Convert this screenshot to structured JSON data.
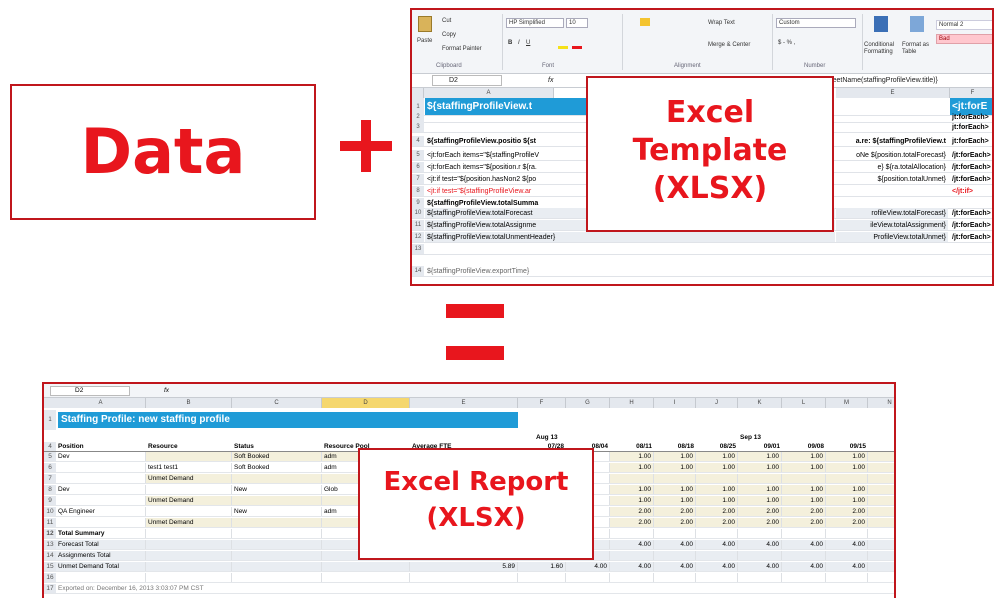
{
  "data_label": "Data",
  "plus_label": "+",
  "template_label": [
    "Excel",
    "Template",
    "(XLSX)"
  ],
  "report_label": [
    "Excel Report",
    "(XLSX)"
  ],
  "colors": {
    "red": "#e8161d",
    "blue": "#1f9bd7"
  },
  "template": {
    "ribbon": {
      "paste": "Paste",
      "cut": "Cut",
      "copy": "Copy",
      "format_painter": "Format Painter",
      "clipboard": "Clipboard",
      "font_name": "HP Simplified",
      "font_size": "10",
      "font": "Font",
      "alignment": "Alignment",
      "wrap_text": "Wrap Text",
      "merge": "Merge & Center",
      "number_format": "Custom",
      "number": "Number",
      "conditional": "Conditional Formatting",
      "format_table": "Format as Table",
      "style_normal": "Normal 2",
      "style_bad": "Bad"
    },
    "name_box": "D2",
    "formula_tail": "rafeSheetName(staffingProfileView.title)}",
    "columns": [
      "A",
      "E",
      "F"
    ],
    "rows": [
      {
        "n": "1",
        "a": "${staffingProfileView.t",
        "e": "",
        "f": "<jt:forE"
      },
      {
        "n": "2",
        "a": "",
        "e": "",
        "f": "jt:forEach>"
      },
      {
        "n": "3",
        "a": "",
        "e": "",
        "f": "jt:forEach>"
      },
      {
        "n": "4",
        "a": "${staffingProfileView.positio ${st",
        "e": "a.re: ${staffingProfileView.t",
        "f": "jt:forEach>"
      },
      {
        "n": "5",
        "a": "<jt:forEach items=\"${staffingProfileV",
        "e": "oNe ${position.totalForecast}",
        "f": "/jt:forEach>"
      },
      {
        "n": "6",
        "a": "<jt:forEach items=\"${position.r ${ra.",
        "e": "e} ${ra.totalAllocation}",
        "f": "/jt:forEach>"
      },
      {
        "n": "7",
        "a": "<jt:if test=\"${position.hasNon2 ${po",
        "e": "${position.totalUnmet}",
        "f": "/jt:forEach>"
      },
      {
        "n": "8",
        "a": "<jt:if test=\"${staffingProfileView.ar",
        "e": "",
        "f": "</jt:if>"
      },
      {
        "n": "9",
        "a": "${staffingProfileView.totalSumma",
        "e": "",
        "f": ""
      },
      {
        "n": "10",
        "a": "${staffingProfileView.totalForecast",
        "e": "rofileView.totalForecast}",
        "f": "/jt:forEach>"
      },
      {
        "n": "11",
        "a": "${staffingProfileView.totalAssignme",
        "e": "ileView.totalAssignment}",
        "f": "/jt:forEach>"
      },
      {
        "n": "12",
        "a": "${staffingProfileView.totalUnmentHeader}",
        "e": "ProfileView.totalUnmet}",
        "f": "/jt:forEach>"
      },
      {
        "n": "13",
        "a": "",
        "e": "",
        "f": ""
      },
      {
        "n": "14",
        "a": "${staffingProfileView.exportTime}",
        "e": "",
        "f": ""
      }
    ]
  },
  "report": {
    "name_box": "D2",
    "columns": [
      "A",
      "B",
      "C",
      "D",
      "E",
      "F",
      "G",
      "H",
      "I",
      "J",
      "K",
      "L",
      "M",
      "N"
    ],
    "title": "Staffing Profile: new staffing profile",
    "month_labels": [
      "Aug 13",
      "Sep 13"
    ],
    "headers": [
      "Position",
      "Resource",
      "Status",
      "Resource Pool",
      "Average FTE",
      "07/28",
      "08/04",
      "08/11",
      "08/18",
      "08/25",
      "09/01",
      "09/08",
      "09/15",
      "09/22"
    ],
    "rows": [
      {
        "n": "5",
        "cells": [
          "Dev",
          "",
          "Soft Booked",
          "adm",
          "",
          "",
          "",
          "1.00",
          "1.00",
          "1.00",
          "1.00",
          "1.00",
          "1.00",
          "1.00"
        ]
      },
      {
        "n": "6",
        "cells": [
          "",
          "test1 test1",
          "Soft Booked",
          "adm",
          "",
          "",
          "",
          "1.00",
          "1.00",
          "1.00",
          "1.00",
          "1.00",
          "1.00",
          "1.00"
        ]
      },
      {
        "n": "7",
        "cells": [
          "",
          "Unmet Demand",
          "",
          "",
          "",
          "",
          "",
          "",
          "",
          "",
          "",
          "",
          "",
          ""
        ]
      },
      {
        "n": "8",
        "cells": [
          "Dev",
          "",
          "New",
          "Glob",
          "",
          "",
          "",
          "1.00",
          "1.00",
          "1.00",
          "1.00",
          "1.00",
          "1.00",
          "1.00"
        ]
      },
      {
        "n": "9",
        "cells": [
          "",
          "Unmet Demand",
          "",
          "",
          "",
          "",
          "",
          "1.00",
          "1.00",
          "1.00",
          "1.00",
          "1.00",
          "1.00",
          "1.00"
        ]
      },
      {
        "n": "10",
        "cells": [
          "QA Engineer",
          "",
          "New",
          "adm",
          "",
          "",
          "",
          "2.00",
          "2.00",
          "2.00",
          "2.00",
          "2.00",
          "2.00",
          "2.00"
        ]
      },
      {
        "n": "11",
        "cells": [
          "",
          "Unmet Demand",
          "",
          "",
          "",
          "",
          "",
          "2.00",
          "2.00",
          "2.00",
          "2.00",
          "2.00",
          "2.00",
          "2.00"
        ]
      },
      {
        "n": "12",
        "cells": [
          "Total Summary",
          "",
          "",
          "",
          "",
          "",
          "",
          "",
          "",
          "",
          "",
          "",
          "",
          ""
        ]
      },
      {
        "n": "13",
        "cells": [
          "Forecast Total",
          "",
          "",
          "",
          "",
          "",
          "",
          "4.00",
          "4.00",
          "4.00",
          "4.00",
          "4.00",
          "4.00",
          "4.00"
        ]
      },
      {
        "n": "14",
        "cells": [
          "Assignments Total",
          "",
          "",
          "",
          "",
          "",
          "",
          "",
          "",
          "",
          "",
          "",
          "",
          ""
        ]
      },
      {
        "n": "15",
        "cells": [
          "Unmet Demand Total",
          "",
          "",
          "",
          "5.89",
          "1.60",
          "4.00",
          "4.00",
          "4.00",
          "4.00",
          "4.00",
          "4.00",
          "4.00",
          "4.00"
        ]
      },
      {
        "n": "16",
        "cells": [
          "",
          "",
          "",
          "",
          "",
          "",
          "",
          "",
          "",
          "",
          "",
          "",
          "",
          ""
        ]
      },
      {
        "n": "17",
        "cells": [
          "Exported on: December 16, 2013 3:03:07 PM CST",
          "",
          "",
          "",
          "",
          "",
          "",
          "",
          "",
          "",
          "",
          "",
          "",
          ""
        ]
      }
    ]
  }
}
